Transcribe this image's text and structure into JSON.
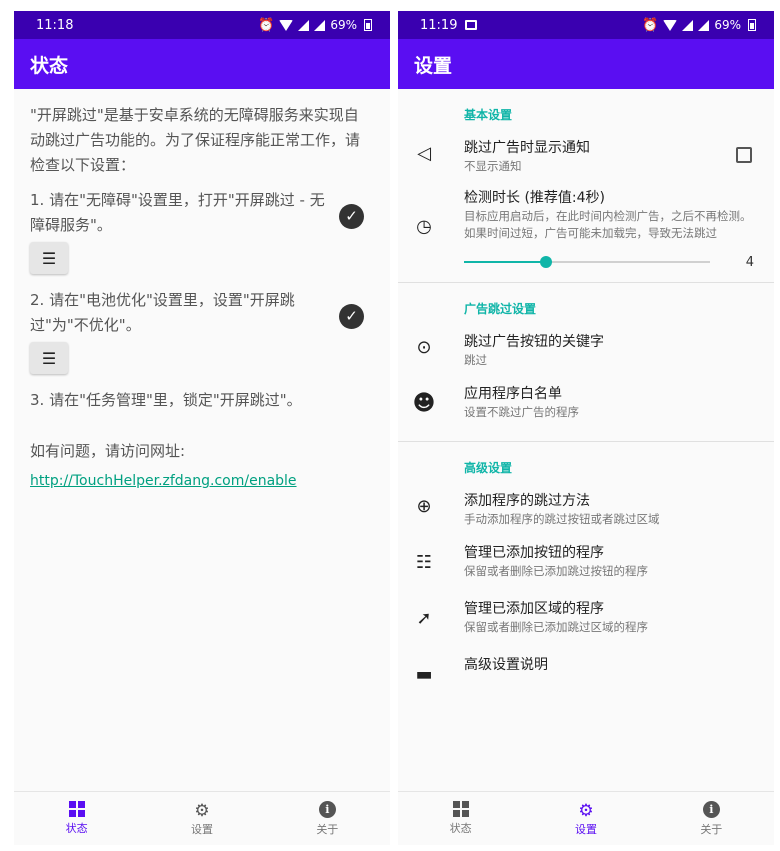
{
  "left": {
    "status_time": "11:18",
    "battery": "69%",
    "appbar_title": "状态",
    "intro": "\"开屏跳过\"是基于安卓系统的无障碍服务来实现自动跳过广告功能的。为了保证程序能正常工作，请检查以下设置：",
    "step1": "1. 请在\"无障碍\"设置里，打开\"开屏跳过 - 无障碍服务\"。",
    "step2": "2. 请在\"电池优化\"设置里，设置\"开屏跳过\"为\"不优化\"。",
    "step3": "3. 请在\"任务管理\"里，锁定\"开屏跳过\"。",
    "contact": "如有问题，请访问网址:",
    "link": "http://TouchHelper.zfdang.com/enable"
  },
  "right": {
    "status_time": "11:19",
    "battery": "69%",
    "appbar_title": "设置",
    "section_basic": "基本设置",
    "notify_title": "跳过广告时显示通知",
    "notify_summary": "不显示通知",
    "duration_title": "检测时长 (推荐值:4秒)",
    "duration_summary": "目标应用启动后，在此时间内检测广告，之后不再检测。如果时间过短，广告可能未加载完，导致无法跳过",
    "duration_value": "4",
    "section_ad": "广告跳过设置",
    "keyword_title": "跳过广告按钮的关键字",
    "keyword_summary": "跳过",
    "whitelist_title": "应用程序白名单",
    "whitelist_summary": "设置不跳过广告的程序",
    "section_adv": "高级设置",
    "add_title": "添加程序的跳过方法",
    "add_summary": "手动添加程序的跳过按钮或者跳过区域",
    "manage_btn_title": "管理已添加按钮的程序",
    "manage_btn_summary": "保留或者删除已添加跳过按钮的程序",
    "manage_area_title": "管理已添加区域的程序",
    "manage_area_summary": "保留或者删除已添加跳过区域的程序",
    "adv_help_title": "高级设置说明"
  },
  "slider": {
    "min": 1,
    "max": 10,
    "value": 4
  },
  "nav": {
    "status": "状态",
    "settings": "设置",
    "about": "关于"
  },
  "colors": {
    "appbar": "#5a0ef2",
    "statusbar": "#3a00b0",
    "accent": "#10b5a8"
  }
}
